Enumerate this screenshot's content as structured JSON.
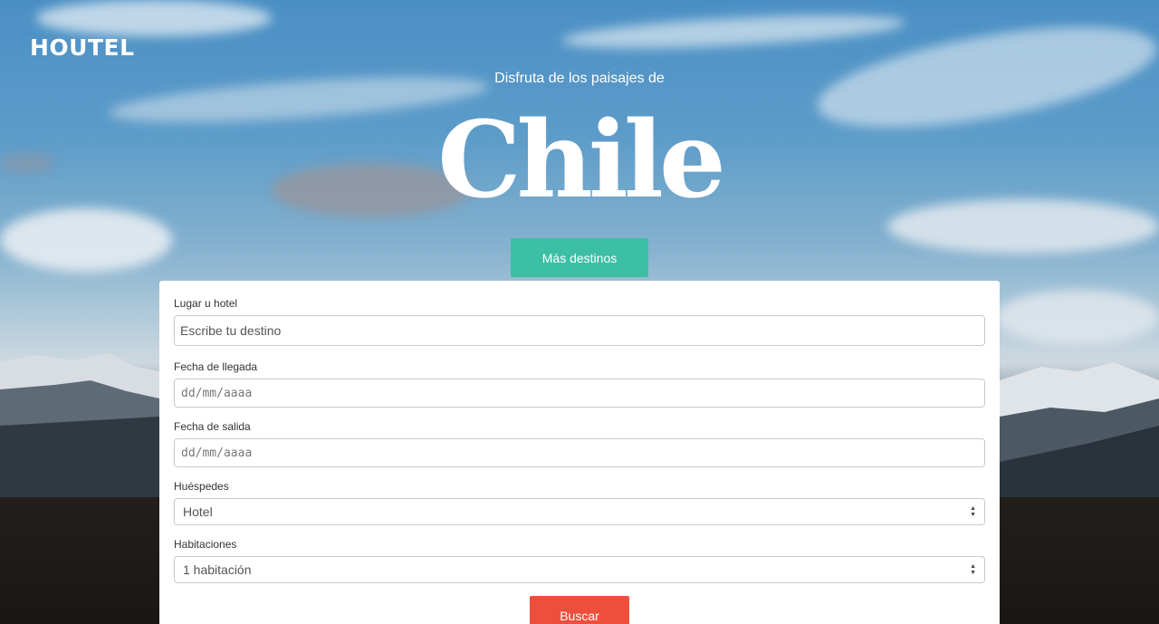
{
  "brand": {
    "logo": "HOUTEL"
  },
  "hero": {
    "subtitle": "Disfruta de los paisajes de",
    "title": "Chile",
    "more_button": "Más destinos"
  },
  "form": {
    "place": {
      "label": "Lugar u hotel",
      "placeholder": "Escribe tu destino"
    },
    "arrival": {
      "label": "Fecha de llegada",
      "value": "dd/mm/aaaa"
    },
    "departure": {
      "label": "Fecha de salida",
      "value": "dd/mm/aaaa"
    },
    "guests": {
      "label": "Huéspedes",
      "selected": "Hotel"
    },
    "rooms": {
      "label": "Habitaciones",
      "selected": "1 habitación"
    },
    "search_button": "Buscar"
  },
  "icons": {
    "select_arrows": "updown-chevron-icon"
  },
  "colors": {
    "accent": "#3dbfa5",
    "search": "#ee4e3c"
  }
}
